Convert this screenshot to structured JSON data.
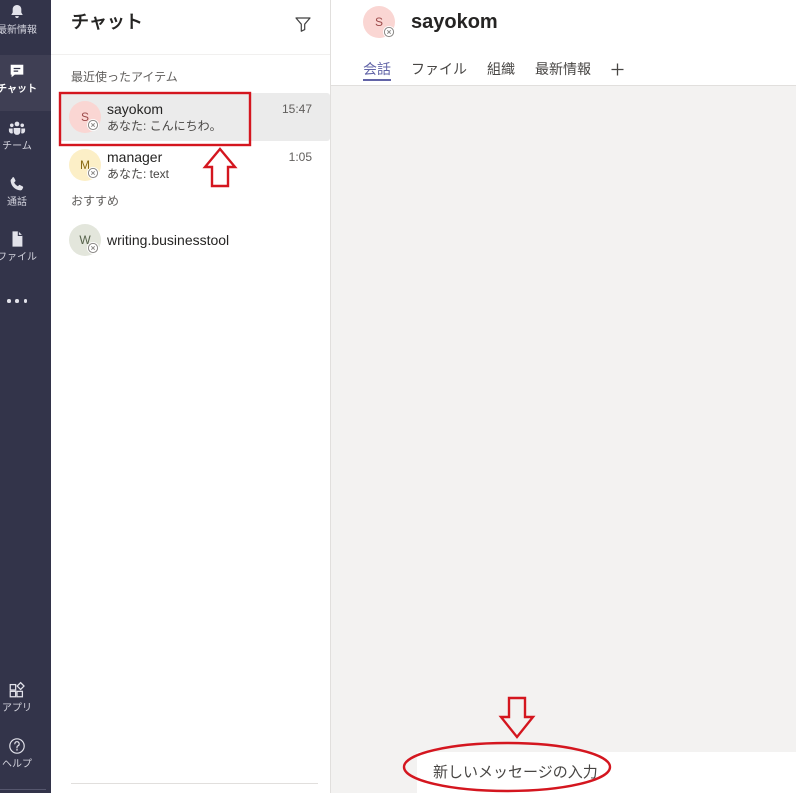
{
  "colors": {
    "rail_bg": "#33344a",
    "accent": "#6264a7",
    "list_bg": "#ffffff",
    "selected_item_bg": "#ebebeb",
    "conversation_bg": "#f3f2f1",
    "annotation_red": "#d4161f"
  },
  "app_rail": {
    "items": [
      {
        "label": "最新情報",
        "icon": "bell-icon"
      },
      {
        "label": "チャット",
        "icon": "chat-icon",
        "active": true
      },
      {
        "label": "チーム",
        "icon": "teams-icon"
      },
      {
        "label": "通話",
        "icon": "phone-icon"
      },
      {
        "label": "ファイル",
        "icon": "file-icon"
      }
    ],
    "more_icon": "more-icon",
    "bottom_items": [
      {
        "label": "アプリ",
        "icon": "apps-icon"
      },
      {
        "label": "ヘルプ",
        "icon": "help-icon"
      }
    ]
  },
  "chat_list": {
    "title": "チャット",
    "filter_icon": "filter-icon",
    "sections": [
      {
        "heading": "最近使ったアイテム",
        "items": [
          {
            "initial": "S",
            "name": "sayokom",
            "time": "15:47",
            "preview": "あなた: こんにちわ。",
            "selected": true,
            "avatar_bg": "#fad6d3",
            "avatar_fg": "#9c4a4a",
            "presence_icon": "presence-unknown-icon"
          },
          {
            "initial": "M",
            "name": "manager",
            "time": "1:05",
            "preview": "あなた: text",
            "avatar_bg": "#fcefc7",
            "avatar_fg": "#8a6a12",
            "presence_icon": "presence-unknown-icon"
          }
        ]
      },
      {
        "heading": "おすすめ",
        "items": [
          {
            "initial": "W",
            "name": "writing.businesstool",
            "avatar_bg": "#e3e6dc",
            "avatar_fg": "#56624b",
            "presence_icon": "presence-unknown-icon"
          }
        ]
      }
    ]
  },
  "conversation": {
    "avatar": {
      "initial": "S",
      "bg": "#fad6d3",
      "fg": "#9c4a4a",
      "presence_icon": "presence-unknown-icon"
    },
    "title": "sayokom",
    "tabs": [
      {
        "label": "会話",
        "active": true
      },
      {
        "label": "ファイル"
      },
      {
        "label": "組織"
      },
      {
        "label": "最新情報"
      }
    ],
    "add_tab_icon": "plus-icon",
    "compose": {
      "placeholder": "新しいメッセージの入力"
    }
  }
}
